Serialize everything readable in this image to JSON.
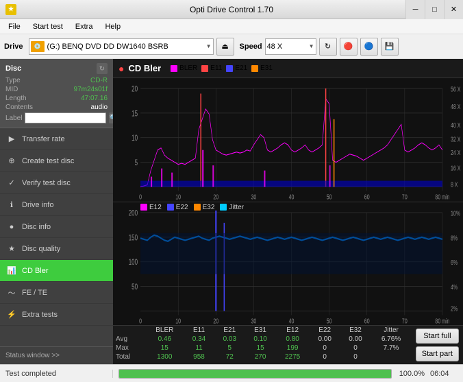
{
  "titlebar": {
    "icon": "★",
    "title": "Opti Drive Control 1.70",
    "min_label": "─",
    "max_label": "□",
    "close_label": "✕"
  },
  "menubar": {
    "items": [
      "File",
      "Start test",
      "Extra",
      "Help"
    ]
  },
  "drivebar": {
    "label": "Drive",
    "drive_value": "(G:)  BENQ DVD DD DW1640 BSRB",
    "speed_label": "Speed",
    "speed_value": "48 X"
  },
  "disc": {
    "title": "Disc",
    "fields": [
      {
        "label": "Type",
        "value": "CD-R",
        "green": true
      },
      {
        "label": "MID",
        "value": "97m24s01f",
        "green": true
      },
      {
        "label": "Length",
        "value": "47:07.16",
        "green": true
      },
      {
        "label": "Contents",
        "value": "audio",
        "green": false
      },
      {
        "label": "Label",
        "value": "",
        "green": false
      }
    ]
  },
  "sidebar": {
    "items": [
      {
        "label": "Transfer rate",
        "icon": "▶",
        "active": false
      },
      {
        "label": "Create test disc",
        "icon": "⊕",
        "active": false
      },
      {
        "label": "Verify test disc",
        "icon": "✓",
        "active": false
      },
      {
        "label": "Drive info",
        "icon": "ℹ",
        "active": false
      },
      {
        "label": "Disc info",
        "icon": "💿",
        "active": false
      },
      {
        "label": "Disc quality",
        "icon": "★",
        "active": false
      },
      {
        "label": "CD Bler",
        "icon": "📊",
        "active": true
      },
      {
        "label": "FE / TE",
        "icon": "~",
        "active": false
      },
      {
        "label": "Extra tests",
        "icon": "⚡",
        "active": false
      }
    ],
    "status_btn": "Status window >>"
  },
  "chart": {
    "icon": "●",
    "title": "CD Bler",
    "top_legend": [
      {
        "label": "BLER",
        "color": "#ff00ff"
      },
      {
        "label": "E11",
        "color": "#ff4444"
      },
      {
        "label": "E21",
        "color": "#4444ff"
      },
      {
        "label": "E31",
        "color": "#ff8800"
      }
    ],
    "bottom_legend": [
      {
        "label": "E12",
        "color": "#ff00ff"
      },
      {
        "label": "E22",
        "color": "#4444ff"
      },
      {
        "label": "E32",
        "color": "#ff8800"
      },
      {
        "label": "Jitter",
        "color": "#00ccff"
      }
    ],
    "top_y_labels": [
      "20",
      "15",
      "10",
      "5",
      ""
    ],
    "top_y_right": [
      "56 X",
      "48 X",
      "40 X",
      "32 X",
      "24 X",
      "16 X",
      "8 X"
    ],
    "bottom_y_labels": [
      "200",
      "150",
      "100",
      "50",
      ""
    ],
    "bottom_y_right": [
      "10%",
      "8%",
      "6%",
      "4%",
      "2%"
    ],
    "x_labels": [
      "0",
      "10",
      "20",
      "30",
      "40",
      "50",
      "60",
      "70",
      "80 min"
    ]
  },
  "stats": {
    "headers": [
      "",
      "BLER",
      "E11",
      "E21",
      "E31",
      "E12",
      "E22",
      "E32",
      "Jitter"
    ],
    "rows": [
      {
        "label": "Avg",
        "values": [
          "0.46",
          "0.34",
          "0.03",
          "0.10",
          "0.80",
          "0.00",
          "0.00",
          "6.76%"
        ]
      },
      {
        "label": "Max",
        "values": [
          "15",
          "11",
          "5",
          "15",
          "199",
          "0",
          "0",
          "7.7%"
        ]
      },
      {
        "label": "Total",
        "values": [
          "1300",
          "958",
          "72",
          "270",
          "2275",
          "0",
          "0",
          ""
        ]
      }
    ]
  },
  "buttons": {
    "start_full": "Start full",
    "start_part": "Start part"
  },
  "bottombar": {
    "status": "Test completed",
    "progress_pct": "100.0%",
    "time": "06:04"
  }
}
